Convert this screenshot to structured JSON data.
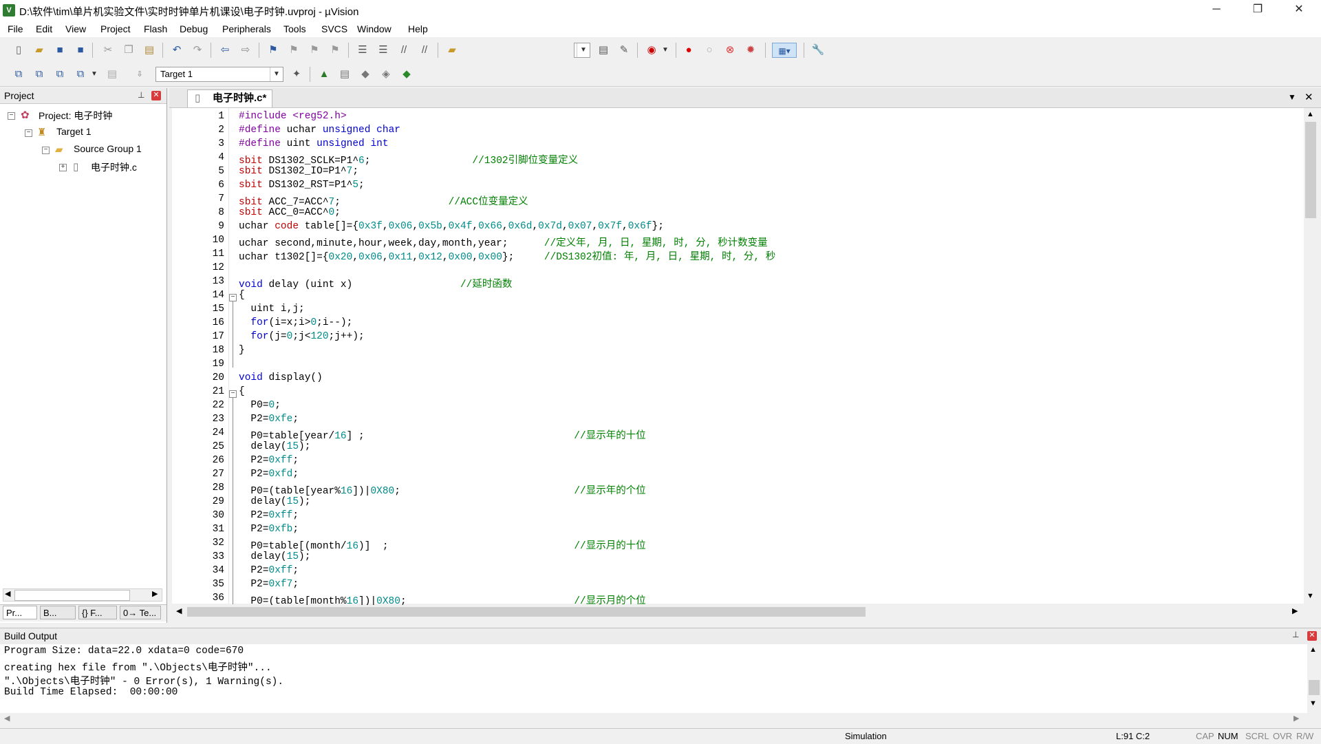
{
  "window": {
    "title": "D:\\软件\\tim\\单片机实验文件\\实时时钟单片机课设\\电子时钟.uvproj - µVision",
    "minimize": "─",
    "restore": "❐",
    "close": "✕"
  },
  "menu": [
    "File",
    "Edit",
    "View",
    "Project",
    "Flash",
    "Debug",
    "Peripherals",
    "Tools",
    "SVCS",
    "Window",
    "Help"
  ],
  "toolbar": {
    "target_combo": "Target 1"
  },
  "project_pane": {
    "title": "Project",
    "root": "Project: 电子时钟",
    "target": "Target 1",
    "group": "Source Group 1",
    "file": "电子时钟.c",
    "tabs": [
      "Pr...",
      "B...",
      "{} F...",
      "0→ Te..."
    ]
  },
  "editor": {
    "tab_label": "电子时钟.c*",
    "line_numbers": [
      "1",
      "2",
      "3",
      "4",
      "5",
      "6",
      "7",
      "8",
      "9",
      "10",
      "11",
      "12",
      "13",
      "14",
      "15",
      "16",
      "17",
      "18",
      "19",
      "20",
      "21",
      "22",
      "23",
      "24",
      "25",
      "26",
      "27",
      "28",
      "29",
      "30",
      "31",
      "32",
      "33",
      "34",
      "35",
      "36"
    ],
    "lines": [
      "#include <reg52.h>",
      "#define uchar unsigned char",
      "#define uint unsigned int",
      "sbit DS1302_SCLK=P1^6;                 //1302引脚位变量定义",
      "sbit DS1302_IO=P1^7;",
      "sbit DS1302_RST=P1^5;",
      "sbit ACC_7=ACC^7;                  //ACC位变量定义",
      "sbit ACC_0=ACC^0;",
      "uchar code table[]={0x3f,0x06,0x5b,0x4f,0x66,0x6d,0x7d,0x07,0x7f,0x6f};",
      "uchar second,minute,hour,week,day,month,year;      //定义年, 月, 日, 星期, 时, 分, 秒计数变量",
      "uchar t1302[]={0x20,0x06,0x11,0x12,0x00,0x00};     //DS1302初值: 年, 月, 日, 星期, 时, 分, 秒",
      "",
      "void delay (uint x)                  //延时函数",
      "{",
      "  uint i,j;",
      "  for(i=x;i>0;i--);",
      "  for(j=0;j<120;j++);",
      "}",
      "",
      "void display()",
      "{",
      "  P0=0;",
      "  P2=0xfe;",
      "  P0=table[year/16] ;                                   //显示年的十位",
      "  delay(15);",
      "  P2=0xff;",
      "  P2=0xfd;",
      "  P0=(table[year%16])|0X80;                             //显示年的个位",
      "  delay(15);",
      "  P2=0xff;",
      "  P2=0xfb;",
      "  P0=table[(month/16)]  ;                               //显示月的十位",
      "  delay(15);",
      "  P2=0xff;",
      "  P2=0xf7;",
      "  P0=(table[month%16])|0X80;                            //显示月的个位"
    ]
  },
  "build_output": {
    "title": "Build Output",
    "lines": [
      "Program Size: data=22.0 xdata=0 code=670",
      "creating hex file from \".\\Objects\\电子时钟\"...",
      "\".\\Objects\\电子时钟\" - 0 Error(s), 1 Warning(s).",
      "Build Time Elapsed:  00:00:00"
    ]
  },
  "status": {
    "mode": "Simulation",
    "position": "L:91 C:2",
    "indicators": [
      "CAP",
      "NUM",
      "SCRL",
      "OVR",
      "R/W"
    ]
  },
  "colors": {
    "keyword": "#0000d0",
    "preprocessor": "#8000a0",
    "sbit": "#c00000",
    "number": "#008b8b",
    "comment": "#008000"
  }
}
